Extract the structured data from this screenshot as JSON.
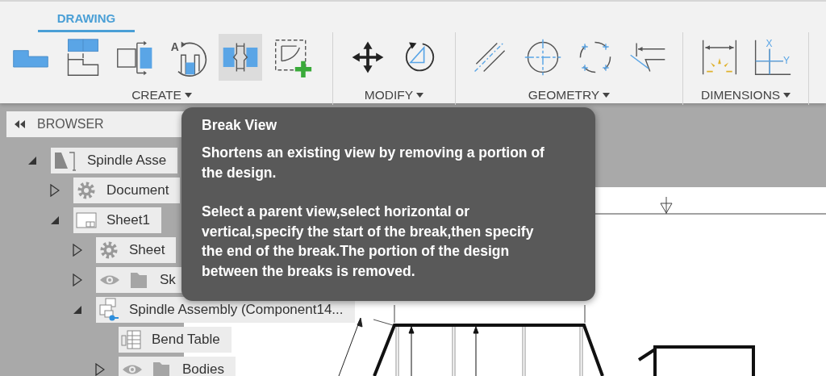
{
  "ribbon": {
    "tab": {
      "label": "DRAWING",
      "selected": true
    },
    "groups": [
      {
        "label": "CREATE",
        "tools": [
          {
            "selected": false
          },
          {
            "selected": false
          },
          {
            "selected": false
          },
          {
            "selected": false,
            "letters": [
              "A"
            ]
          },
          {
            "selected": true
          },
          {
            "selected": false
          }
        ]
      },
      {
        "label": "MODIFY",
        "tools": [
          {
            "selected": false
          },
          {
            "selected": false
          }
        ]
      },
      {
        "label": "GEOMETRY",
        "tools": [
          {
            "selected": false
          },
          {
            "selected": false
          },
          {
            "selected": false
          },
          {
            "selected": false
          }
        ]
      },
      {
        "label": "DIMENSIONS",
        "tools": [
          {
            "selected": false
          },
          {
            "selected": false,
            "letters": [
              "X",
              "Y"
            ]
          }
        ]
      }
    ]
  },
  "browser": {
    "title": "BROWSER",
    "tree": [
      {
        "label": "Spindle Asse",
        "kind": "drawing",
        "expanded": true,
        "children": [
          {
            "label": "Document",
            "kind": "settings",
            "expanded": false
          },
          {
            "label": "Sheet1",
            "kind": "sheet",
            "expanded": true,
            "children": [
              {
                "label": "Sheet",
                "kind": "settings",
                "expanded": false
              },
              {
                "label": "Sk",
                "kind": "folder",
                "expanded": false
              },
              {
                "label": "Spindle Assembly (Component14...",
                "kind": "component",
                "expanded": true,
                "children": [
                  {
                    "label": "Bend Table",
                    "kind": "table"
                  },
                  {
                    "label": "Bodies",
                    "kind": "folder",
                    "expanded": false
                  }
                ]
              }
            ]
          }
        ]
      }
    ]
  },
  "tooltip": {
    "title": "Break View",
    "paragraphs": [
      "Shortens an existing view by removing a portion of the design.",
      "Select a parent view,select horizontal or vertical,specify the start of the break,then specify the end of the break.The portion of the design between the breaks is removed."
    ]
  }
}
